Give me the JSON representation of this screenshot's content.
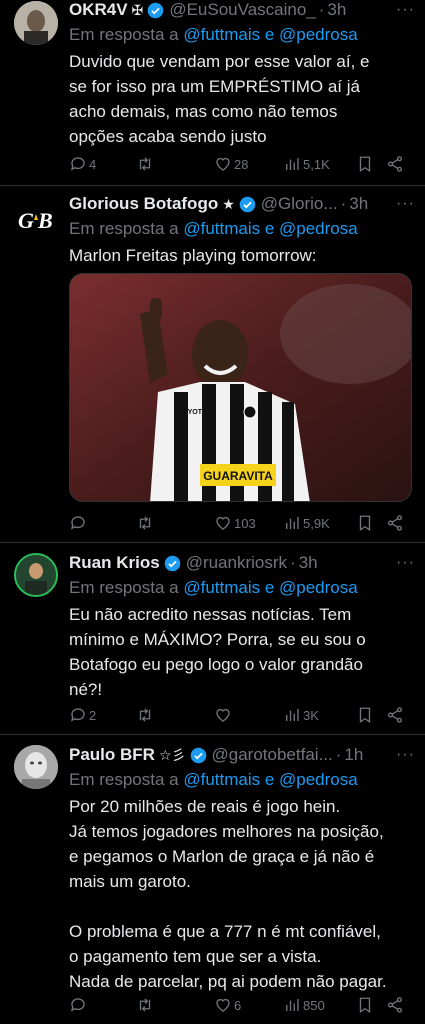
{
  "tweets": [
    {
      "name": "OKR4V",
      "extra": "✠",
      "handle": "@EuSouVascaino_",
      "time": "3h",
      "reply_prefix": "Em resposta a",
      "reply_mentions": "@futtmais e @pedrosa",
      "body": [
        "Duvido que vendam por esse valor aí, e",
        "se for isso pra um EMPRÉSTIMO aí já",
        "acho demais, mas como não temos",
        "opções acaba sendo justo"
      ],
      "replies": "4",
      "retweets": "",
      "likes": "28",
      "views": "5,1K"
    },
    {
      "name": "Glorious Botafogo",
      "extra": "★",
      "handle": "@Glorio...",
      "time": "3h",
      "reply_prefix": "Em resposta a",
      "reply_mentions": "@futtmais e @pedrosa",
      "body": [
        "Marlon Freitas playing tomorrow:"
      ],
      "replies": "",
      "retweets": "",
      "likes": "103",
      "views": "5,9K",
      "media_text": "GUARAVITA",
      "media_sponsor": "TOYOTA"
    },
    {
      "name": "Ruan Krios",
      "extra": "",
      "handle": "@ruankriosrk",
      "time": "3h",
      "reply_prefix": "Em resposta a",
      "reply_mentions": "@futtmais e @pedrosa",
      "body": [
        "Eu não acredito nessas notícias. Tem",
        "mínimo e MÁXIMO? Porra, se eu sou o",
        "Botafogo eu pego logo o valor grandão",
        "né?!"
      ],
      "replies": "2",
      "retweets": "",
      "likes": "",
      "views": "3K"
    },
    {
      "name": "Paulo BFR",
      "extra": "☆彡",
      "handle": "@garotobetfai...",
      "time": "1h",
      "reply_prefix": "Em resposta a",
      "reply_mentions": "@futtmais e @pedrosa",
      "body": [
        "Por 20 milhões de reais é jogo hein.",
        "Já temos jogadores melhores na posição,",
        "e pegamos o Marlon de graça e já não é",
        "mais um garoto.",
        "",
        "O problema é que a 777 n é mt confiável,",
        "o pagamento tem que ser a vista.",
        "Nada de parcelar, pq ai podem não pagar."
      ],
      "replies": "",
      "retweets": "",
      "likes": "6",
      "views": "850"
    }
  ],
  "colors": {
    "accent": "#1d9bf0",
    "muted": "#71767b",
    "text": "#e7e9ea",
    "divider": "#2f3336"
  }
}
